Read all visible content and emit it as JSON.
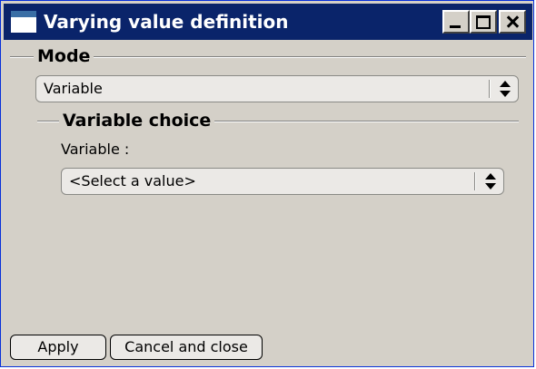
{
  "window": {
    "title": "Varying value definition"
  },
  "mode": {
    "group_label": "Mode",
    "selected_value": "Variable"
  },
  "variable_choice": {
    "group_label": "Variable choice",
    "field_label": "Variable :",
    "selected_value": "<Select a value>"
  },
  "buttons": {
    "apply": "Apply",
    "cancel_close": "Cancel and close"
  }
}
